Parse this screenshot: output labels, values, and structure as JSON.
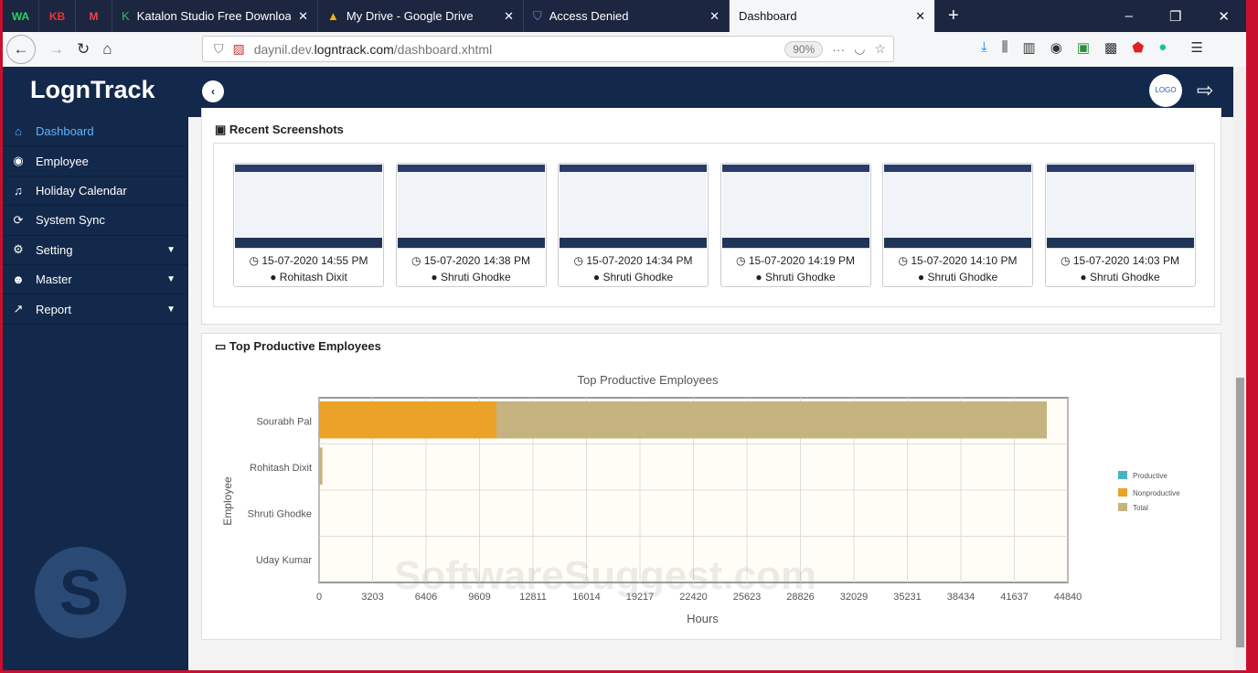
{
  "browser": {
    "pinned": [
      "WA",
      "KB",
      "M"
    ],
    "tabs": [
      {
        "label": "Katalon Studio Free Download"
      },
      {
        "label": "My Drive - Google Drive"
      },
      {
        "label": "Access Denied"
      },
      {
        "label": "Dashboard"
      }
    ],
    "url_prefix": "daynil.dev.",
    "url_domain": "logntrack.com",
    "url_path": "/dashboard.xhtml",
    "zoom": "90%"
  },
  "app": {
    "logo": "LognTrack",
    "avatar_text": "LOGO"
  },
  "sidebar": {
    "items": [
      {
        "label": "Dashboard",
        "icon": "home"
      },
      {
        "label": "Employee",
        "icon": "user"
      },
      {
        "label": "Holiday Calendar",
        "icon": "bell"
      },
      {
        "label": "System Sync",
        "icon": "sync"
      },
      {
        "label": "Setting",
        "icon": "gear"
      },
      {
        "label": "Master",
        "icon": "users"
      },
      {
        "label": "Report",
        "icon": "chart"
      }
    ]
  },
  "screenshots": {
    "title": "Recent Screenshots",
    "items": [
      {
        "time": "15-07-2020 14:55 PM",
        "user": "Rohitash Dixit"
      },
      {
        "time": "15-07-2020 14:38 PM",
        "user": "Shruti Ghodke"
      },
      {
        "time": "15-07-2020 14:34 PM",
        "user": "Shruti Ghodke"
      },
      {
        "time": "15-07-2020 14:19 PM",
        "user": "Shruti Ghodke"
      },
      {
        "time": "15-07-2020 14:10 PM",
        "user": "Shruti Ghodke"
      },
      {
        "time": "15-07-2020 14:03 PM",
        "user": "Shruti Ghodke"
      }
    ]
  },
  "productive": {
    "title": "Top Productive Employees"
  },
  "watermark": "SoftwareSuggest.com",
  "chart_data": {
    "type": "bar",
    "orientation": "horizontal",
    "title": "Top Productive Employees",
    "xlabel": "Hours",
    "ylabel": "Employee",
    "categories": [
      "Sourabh Pal",
      "Rohitash Dixit",
      "Shruti Ghodke",
      "Uday Kumar"
    ],
    "series": [
      {
        "name": "Productive",
        "color": "#4bb2c5",
        "values": [
          0,
          0,
          0,
          0
        ]
      },
      {
        "name": "Nonproductive",
        "color": "#eaa228",
        "values": [
          10620,
          0,
          0,
          0
        ]
      },
      {
        "name": "Total",
        "color": "#c5b47f",
        "values": [
          43580,
          200,
          0,
          0
        ]
      }
    ],
    "xlim": [
      0,
      44840
    ],
    "xticks": [
      "0",
      "3203",
      "6406",
      "9609",
      "12811",
      "16014",
      "19217",
      "22420",
      "25623",
      "28826",
      "32029",
      "35231",
      "38434",
      "41637",
      "44840"
    ],
    "legend": "right",
    "grid": true
  }
}
